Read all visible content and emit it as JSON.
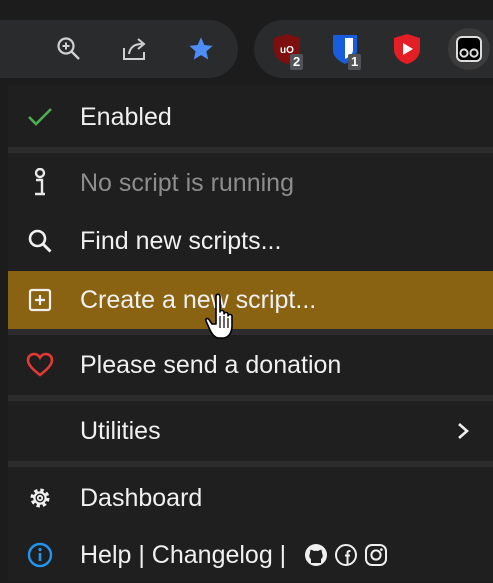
{
  "toolbar": {
    "icons": [
      "zoom-icon",
      "share-icon",
      "bookmark-star-icon"
    ],
    "extensions": [
      {
        "name": "ublock-origin",
        "badge": "2",
        "color": "#7d0f0f"
      },
      {
        "name": "bitwarden",
        "badge": "1",
        "color": "#175ddc"
      },
      {
        "name": "youtube-extension",
        "badge": "",
        "color": "#e31e24"
      },
      {
        "name": "tampermonkey",
        "badge": "",
        "color": "#2b2b2b"
      }
    ]
  },
  "menu": {
    "enabled_label": "Enabled",
    "no_script_label": "No script is running",
    "find_scripts_label": "Find new scripts...",
    "create_script_label": "Create a new script...",
    "donation_label": "Please send a donation",
    "utilities_label": "Utilities",
    "dashboard_label": "Dashboard",
    "help_label": "Help | Changelog |"
  },
  "colors": {
    "highlight": "#8a6312",
    "check": "#4caf50",
    "heart": "#e53935",
    "info": "#2196f3"
  }
}
